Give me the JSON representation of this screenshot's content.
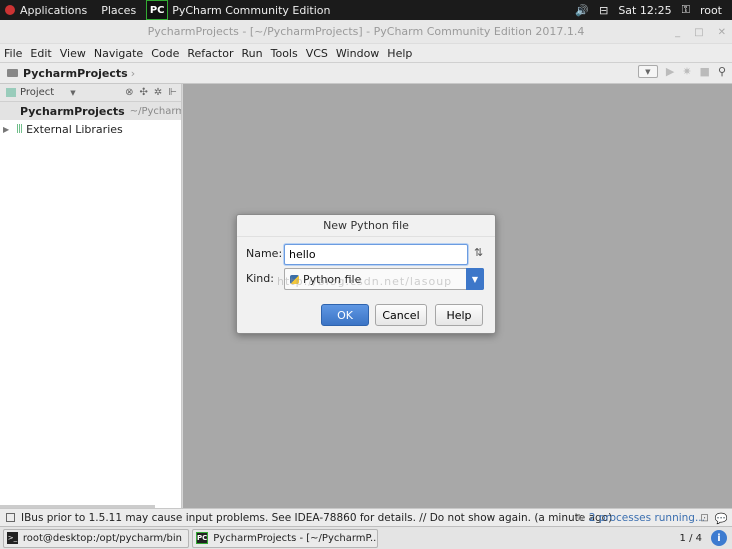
{
  "topbar": {
    "applications": "Applications",
    "places": "Places",
    "app_icon_text": "PC",
    "app_name": "PyCharm Community Edition",
    "clock": "Sat 12:25",
    "user": "root",
    "volume_icon": "speaker-icon",
    "network_icon": "network-icon",
    "user_icon": "user-menu-icon"
  },
  "window": {
    "title": "PycharmProjects - [~/PycharmProjects] - PyCharm Community Edition 2017.1.4"
  },
  "menu": {
    "items": [
      "File",
      "Edit",
      "View",
      "Navigate",
      "Code",
      "Refactor",
      "Run",
      "Tools",
      "VCS",
      "Window",
      "Help"
    ]
  },
  "navbar": {
    "breadcrumb": "PycharmProjects"
  },
  "project_panel": {
    "header_label": "Project",
    "root_name": "PycharmProjects",
    "root_path": "~/PycharmPr",
    "external_libraries": "External Libraries"
  },
  "dialog": {
    "title": "New Python file",
    "name_label": "Name:",
    "name_value": "hello",
    "kind_label": "Kind:",
    "kind_value": "Python file",
    "ok_label": "OK",
    "cancel_label": "Cancel",
    "help_label": "Help",
    "watermark": "http://blog.csdn.net/lasoup"
  },
  "status": {
    "message": "IBus prior to 1.5.11 may cause input problems. See IDEA-78860 for details. // Do not show again. (a minute ago)",
    "processes": "2 processes running..."
  },
  "taskbar": {
    "terminal_task": "root@desktop:/opt/pycharm/bin",
    "pycharm_task": "PycharmProjects - [~/PycharmP...",
    "pager": "1 / 4"
  },
  "colors": {
    "accent": "#3b74c5",
    "editor_bg": "#a8a8a8"
  }
}
